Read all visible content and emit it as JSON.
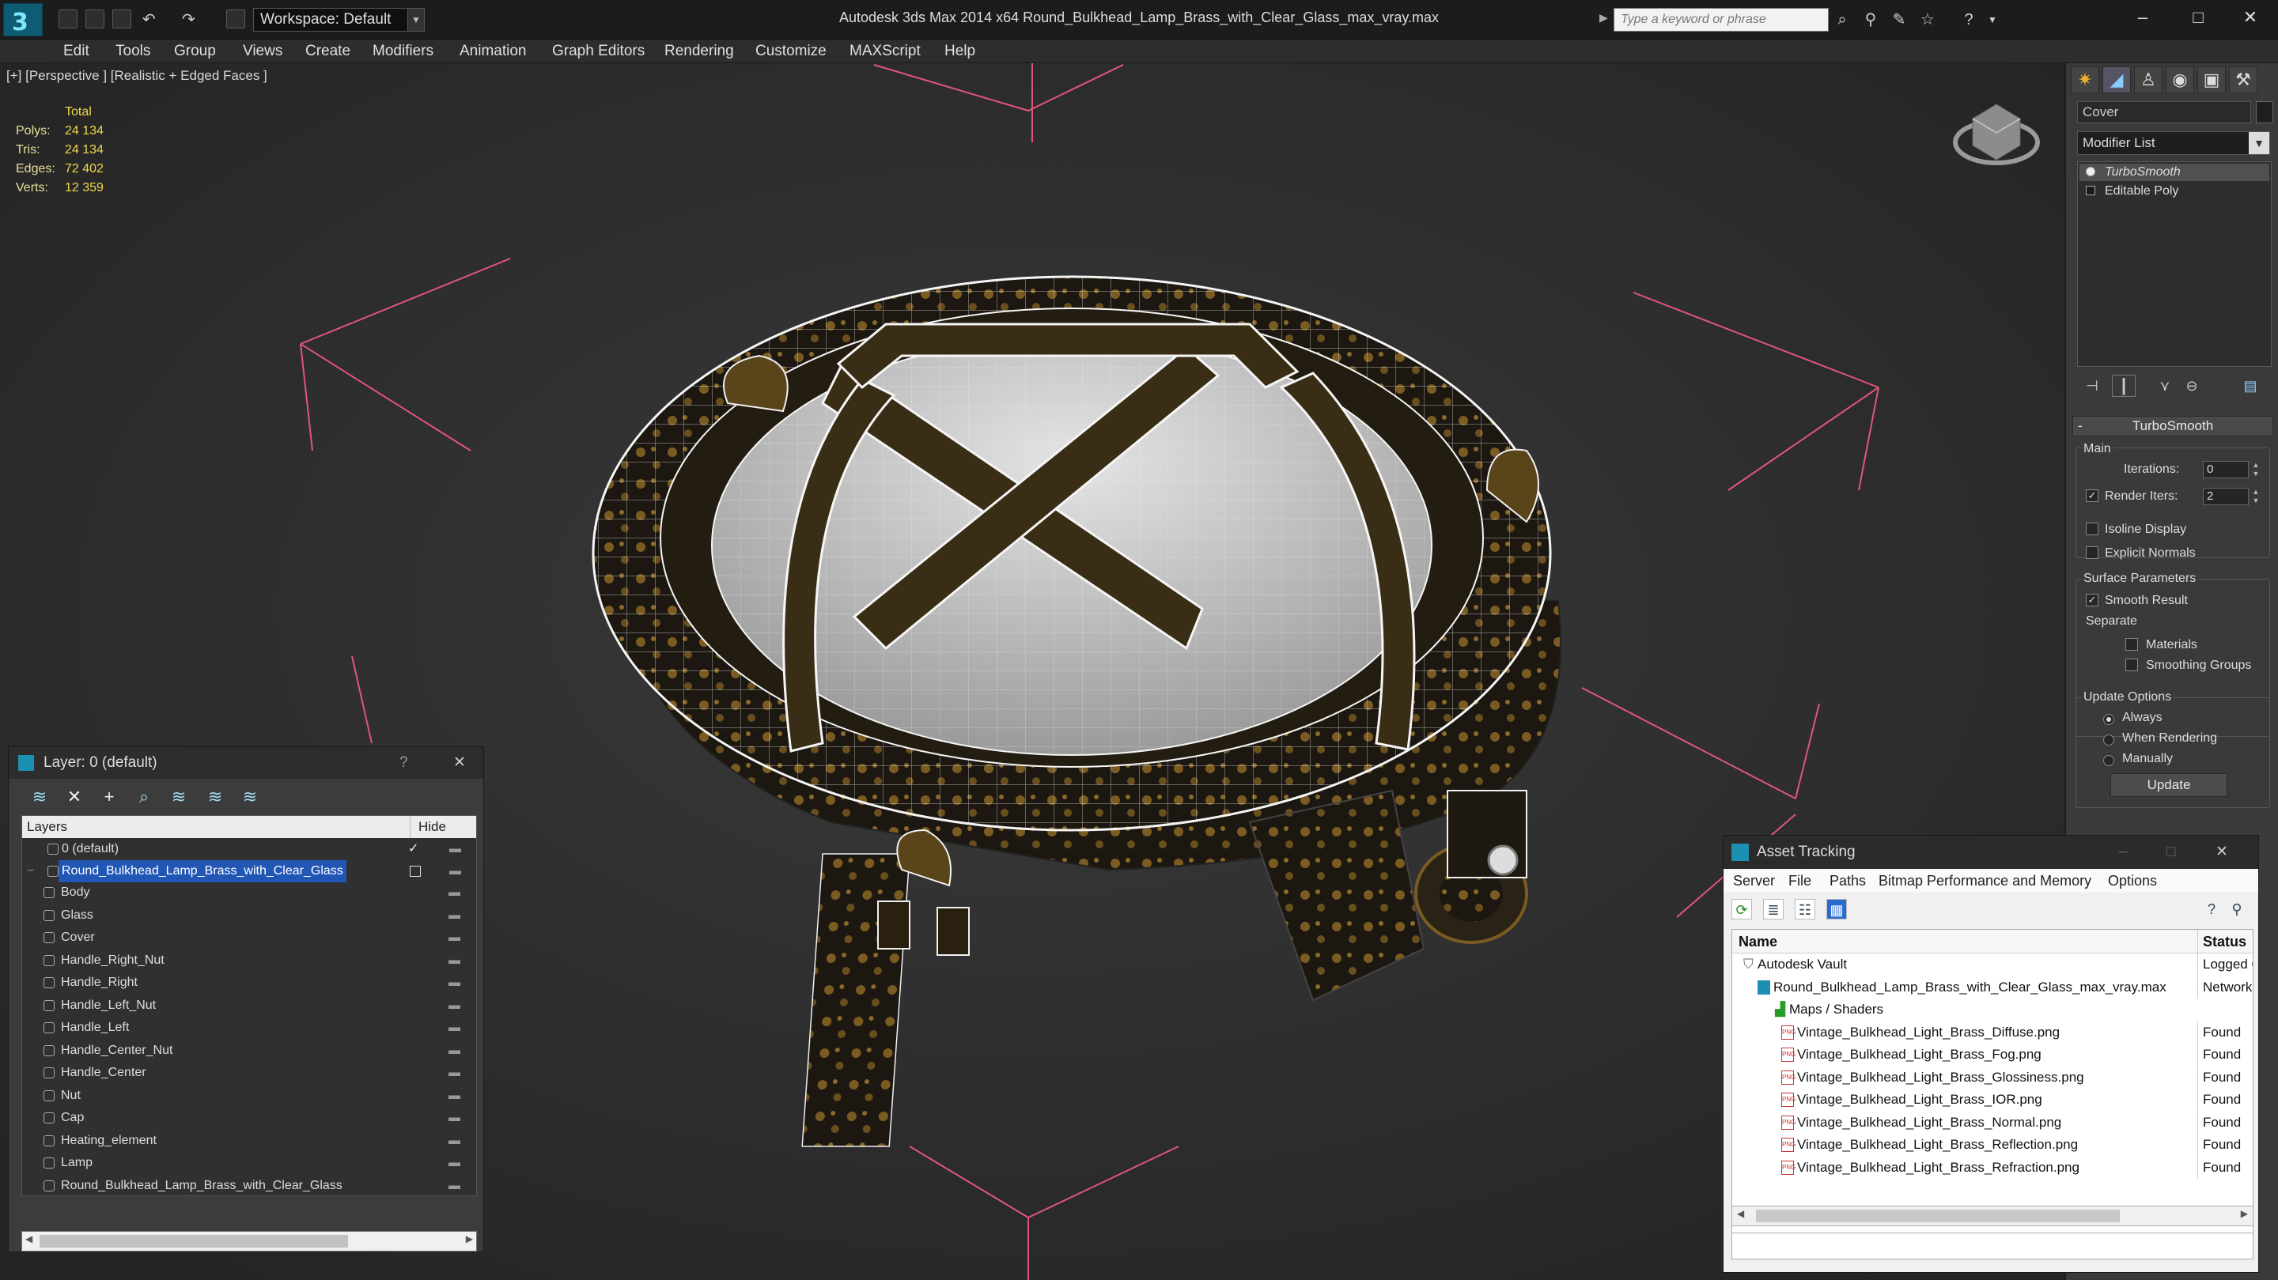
{
  "titlebar": {
    "workspace_label": "Workspace: Default",
    "app_title": "Autodesk 3ds Max  2014 x64     Round_Bulkhead_Lamp_Brass_with_Clear_Glass_max_vray.max",
    "search_placeholder": "Type a keyword or phrase",
    "window_buttons": [
      "–",
      "□",
      "✕"
    ]
  },
  "menu": [
    "Edit",
    "Tools",
    "Group",
    "Views",
    "Create",
    "Modifiers",
    "Animation",
    "Graph Editors",
    "Rendering",
    "Customize",
    "MAXScript",
    "Help"
  ],
  "viewport": {
    "label": "[+] [Perspective ] [Realistic + Edged Faces ]",
    "stats": {
      "header": "Total",
      "rows": [
        {
          "key": "Polys:",
          "value": "24 134"
        },
        {
          "key": "Tris:",
          "value": "24 134"
        },
        {
          "key": "Edges:",
          "value": "72 402"
        },
        {
          "key": "Verts:",
          "value": "12 359"
        }
      ]
    }
  },
  "command_panel": {
    "object_name": "Cover",
    "modifier_list_label": "Modifier List",
    "stack": [
      "TurboSmooth",
      "Editable Poly"
    ],
    "rollout_title": "TurboSmooth",
    "main_group": "Main",
    "iterations_label": "Iterations:",
    "iterations_value": "0",
    "render_iters_label": "Render Iters:",
    "render_iters_value": "2",
    "isoline_label": "Isoline Display",
    "explicit_normals_label": "Explicit Normals",
    "surface_group": "Surface Parameters",
    "smooth_result_label": "Smooth Result",
    "separate_label": "Separate",
    "materials_label": "Materials",
    "smoothing_groups_label": "Smoothing Groups",
    "update_group": "Update Options",
    "update_options": [
      "Always",
      "When Rendering",
      "Manually"
    ],
    "update_button": "Update"
  },
  "layer_panel": {
    "title": "Layer: 0 (default)",
    "help": "?",
    "close": "✕",
    "col_layers": "Layers",
    "col_hide": "Hide",
    "default_layer": "0 (default)",
    "selected_layer": "Round_Bulkhead_Lamp_Brass_with_Clear_Glass",
    "objects": [
      "Body",
      "Glass",
      "Cover",
      "Handle_Right_Nut",
      "Handle_Right",
      "Handle_Left_Nut",
      "Handle_Left",
      "Handle_Center_Nut",
      "Handle_Center",
      "Nut",
      "Cap",
      "Heating_element",
      "Lamp",
      "Round_Bulkhead_Lamp_Brass_with_Clear_Glass"
    ]
  },
  "asset_tracking": {
    "title": "Asset Tracking",
    "menu": [
      "Server",
      "File",
      "Paths",
      "Bitmap Performance and Memory",
      "Options"
    ],
    "col_name": "Name",
    "col_status": "Status",
    "rows": [
      {
        "name": "Autodesk Vault",
        "status": "Logged Out"
      },
      {
        "name": "Round_Bulkhead_Lamp_Brass_with_Clear_Glass_max_vray.max",
        "status": "Network"
      },
      {
        "name": "Maps / Shaders",
        "status": ""
      },
      {
        "name": "Vintage_Bulkhead_Light_Brass_Diffuse.png",
        "status": "Found"
      },
      {
        "name": "Vintage_Bulkhead_Light_Brass_Fog.png",
        "status": "Found"
      },
      {
        "name": "Vintage_Bulkhead_Light_Brass_Glossiness.png",
        "status": "Found"
      },
      {
        "name": "Vintage_Bulkhead_Light_Brass_IOR.png",
        "status": "Found"
      },
      {
        "name": "Vintage_Bulkhead_Light_Brass_Normal.png",
        "status": "Found"
      },
      {
        "name": "Vintage_Bulkhead_Light_Brass_Reflection.png",
        "status": "Found"
      },
      {
        "name": "Vintage_Bulkhead_Light_Brass_Refraction.png",
        "status": "Found"
      }
    ]
  },
  "colors": {
    "accent": "#2256b5",
    "stats": "#f0d74a",
    "selection_box": "#e0567a",
    "brass": "#8a6a2a"
  }
}
